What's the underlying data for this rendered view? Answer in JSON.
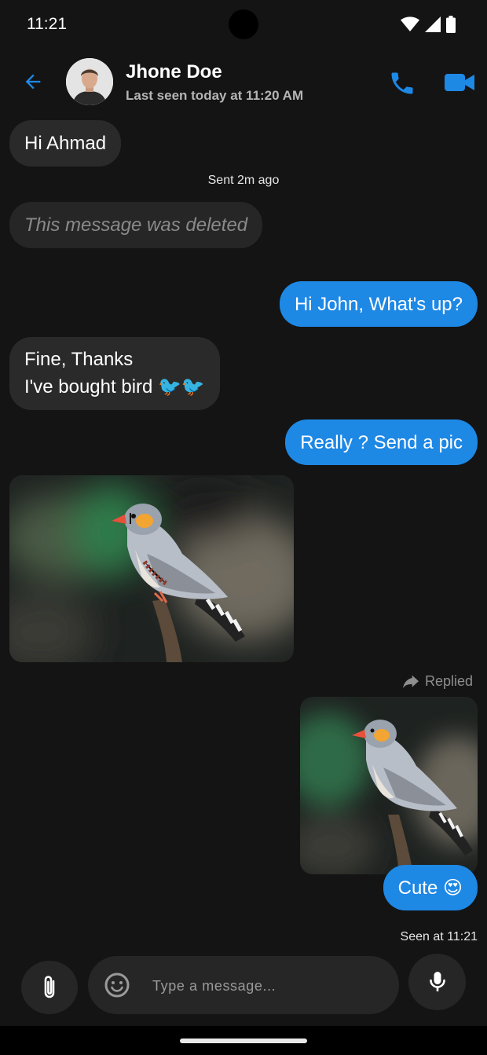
{
  "status_bar": {
    "time": "11:21",
    "icons": [
      "wifi-icon",
      "signal-icon",
      "battery-icon"
    ]
  },
  "header": {
    "back_icon": "arrow-left-icon",
    "contact_name": "Jhone Doe",
    "last_seen": "Last seen today at 11:20 AM",
    "call_icon": "phone-icon",
    "video_icon": "video-camera-icon"
  },
  "messages": [
    {
      "from": "them",
      "text": "Hi Ahmad"
    },
    {
      "meta": "Sent 2m ago"
    },
    {
      "from": "them",
      "text": "This message was deleted",
      "deleted": true
    },
    {
      "from": "me",
      "text": "Hi John, What's up?"
    },
    {
      "from": "them",
      "lines": [
        "Fine, Thanks",
        "I've bought bird 🐦🐦"
      ]
    },
    {
      "from": "me",
      "text": "Really ? Send a pic"
    },
    {
      "from": "them",
      "image": "zebra-finch-photo"
    },
    {
      "reply_label": "Replied",
      "reply_icon": "reply-arrow-icon"
    },
    {
      "from": "me",
      "image": "zebra-finch-photo"
    },
    {
      "from": "me",
      "text": "Cute 😍"
    },
    {
      "meta": "Seen at 11:21"
    }
  ],
  "composer": {
    "placeholder": "Type a message...",
    "value": "",
    "attach_icon": "paperclip-icon",
    "emoji_icon": "emoji-smile-icon",
    "mic_icon": "microphone-icon"
  },
  "colors": {
    "background": "#141414",
    "accent": "#1e88e5",
    "received_bubble": "#2a2a2a",
    "input_surface": "#262626"
  }
}
